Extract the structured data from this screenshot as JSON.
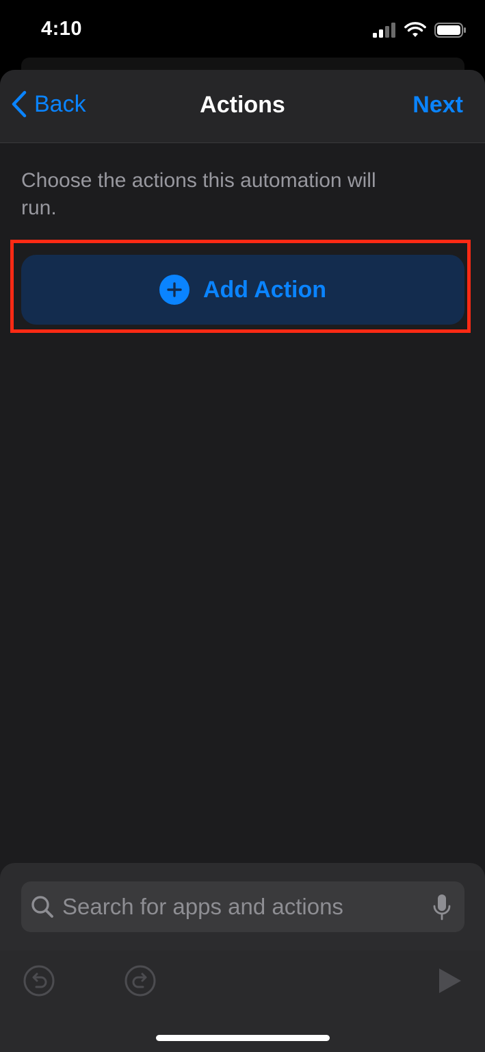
{
  "status": {
    "time": "4:10"
  },
  "nav": {
    "back_label": "Back",
    "title": "Actions",
    "next_label": "Next"
  },
  "main": {
    "description": "Choose the actions this automation will run.",
    "add_action_label": "Add Action"
  },
  "search": {
    "placeholder": "Search for apps and actions"
  },
  "colors": {
    "accent": "#0a84ff",
    "highlight": "#ff2a14",
    "background": "#1c1c1e"
  },
  "icons": [
    "chevron-left-icon",
    "plus-circle-icon",
    "search-icon",
    "microphone-icon",
    "undo-icon",
    "redo-icon",
    "play-icon"
  ]
}
